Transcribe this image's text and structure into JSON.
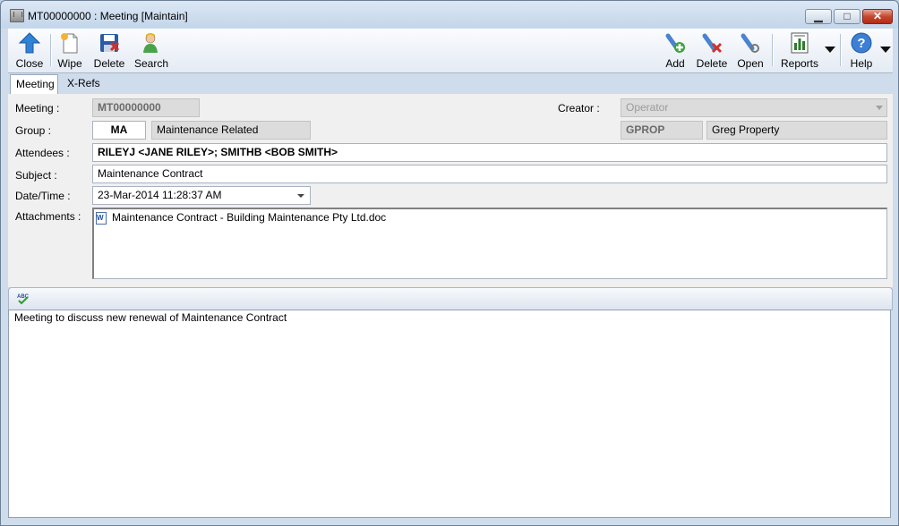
{
  "window": {
    "title": "MT00000000 : Meeting [Maintain]"
  },
  "window_controls": {
    "minimize": "▁",
    "maximize": "□",
    "close": "✕"
  },
  "toolbar": {
    "close": "Close",
    "wipe": "Wipe",
    "delete": "Delete",
    "search": "Search",
    "add": "Add",
    "delete2": "Delete",
    "open": "Open",
    "reports": "Reports",
    "help": "Help"
  },
  "tabs": {
    "meeting": "Meeting",
    "xrefs": "X-Refs"
  },
  "form": {
    "meeting_label": "Meeting :",
    "meeting_value": "MT00000000",
    "creator_label": "Creator :",
    "creator_value": "Operator",
    "group_label": "Group :",
    "group_code": "MA",
    "group_desc": "Maintenance Related",
    "owner_code": "GPROP",
    "owner_name": "Greg Property",
    "attendees_label": "Attendees :",
    "attendees_value": "RILEYJ <JANE RILEY>; SMITHB <BOB SMITH>",
    "subject_label": "Subject :",
    "subject_value": "Maintenance Contract",
    "datetime_label": "Date/Time :",
    "datetime_value": "23-Mar-2014 11:28:37 AM",
    "attachments_label": "Attachments :",
    "attachments": [
      "Maintenance Contract - Building Maintenance Pty Ltd.doc"
    ]
  },
  "notes": {
    "spell_icon": "spell-check-icon",
    "text": "Meeting to discuss new renewal of Maintenance Contract"
  },
  "colors": {
    "accent": "#1f6fc5",
    "close_button": "#c3482f",
    "readonly_field": "#dcdcdc"
  }
}
